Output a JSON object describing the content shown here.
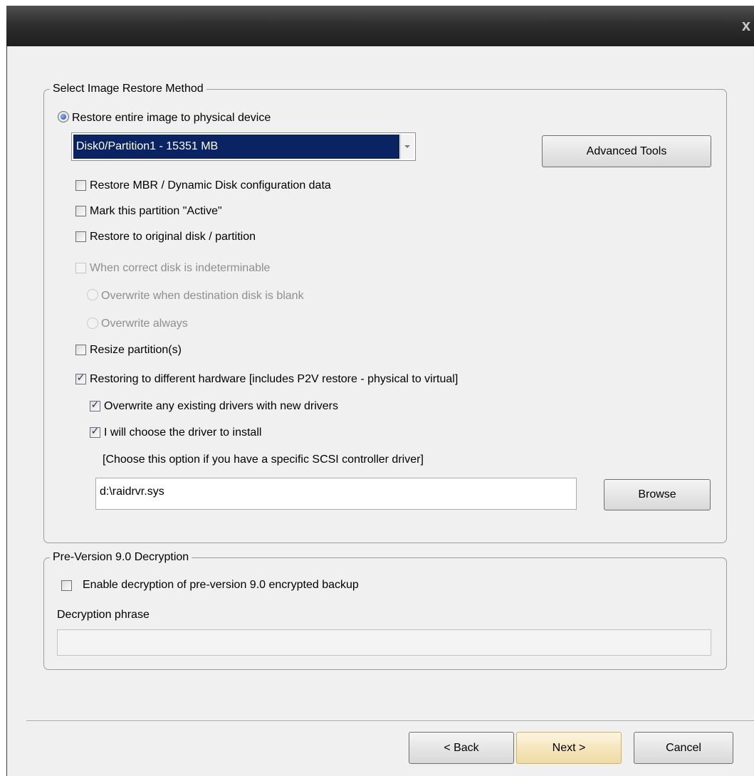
{
  "titlebar": {
    "close_glyph": "x"
  },
  "restore_method": {
    "legend": "Select Image Restore Method",
    "restore_entire": "Restore entire image to physical device",
    "device_select": "Disk0/Partition1 - 15351 MB",
    "advanced_tools": "Advanced Tools",
    "restore_mbr": "Restore MBR / Dynamic Disk configuration data",
    "mark_active": "Mark this partition \"Active\"",
    "restore_original": "Restore to original disk / partition",
    "when_indeterminable": "When correct disk is indeterminable",
    "overwrite_blank": "Overwrite when destination disk is blank",
    "overwrite_always": "Overwrite always",
    "resize_partitions": "Resize partition(s)",
    "different_hardware": "Restoring to different hardware [includes P2V restore - physical to virtual]",
    "overwrite_drivers": "Overwrite any existing drivers with new drivers",
    "choose_driver": "I will choose the driver to install",
    "choose_hint": "[Choose this option if you have a specific SCSI controller driver]",
    "driver_path": "d:\\raidrvr.sys",
    "browse": "Browse"
  },
  "decryption": {
    "legend": "Pre-Version 9.0 Decryption",
    "enable": "Enable decryption of pre-version 9.0 encrypted backup",
    "phrase_label": "Decryption phrase",
    "phrase_value": ""
  },
  "footer": {
    "back": "< Back",
    "next": "Next >",
    "cancel": "Cancel"
  }
}
